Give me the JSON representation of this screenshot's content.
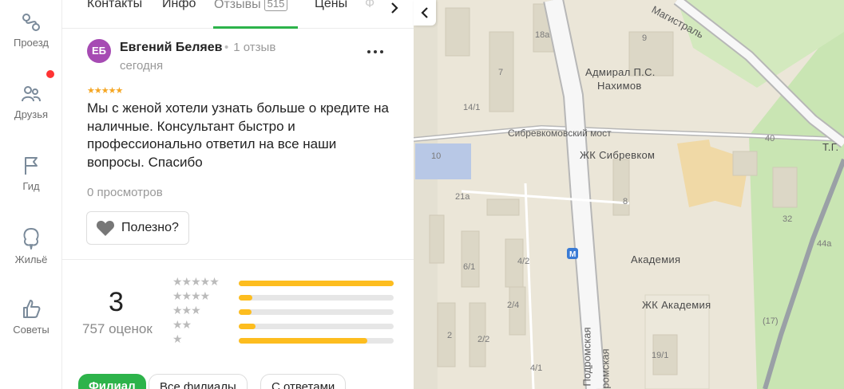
{
  "rail": {
    "items": [
      {
        "label": "Проезд",
        "icon": "route-icon"
      },
      {
        "label": "Друзья",
        "icon": "friends-icon"
      },
      {
        "label": "Гид",
        "icon": "flag-icon"
      },
      {
        "label": "Жильё",
        "icon": "tree-icon"
      },
      {
        "label": "Советы",
        "icon": "thumbs-up-icon"
      }
    ],
    "notification_color": "#ff3333"
  },
  "tabs": {
    "items": [
      {
        "label": "Контакты"
      },
      {
        "label": "Инфо"
      },
      {
        "label": "Отзывы",
        "count": "515",
        "active": true
      },
      {
        "label": "Цены"
      },
      {
        "label": "Ф"
      }
    ],
    "accent": "#2db34a"
  },
  "review": {
    "avatar_initials": "ЕБ",
    "avatar_color": "#a64bb3",
    "author": "Евгений Беляев",
    "author_reviews": "1 отзыв",
    "date": "сегодня",
    "stars": "★★★★★",
    "rating": 5,
    "text": "Мы с женой хотели узнать больше о кредите на наличные. Консультант быстро и профессионально ответил на все наши вопросы. Спасибо",
    "views": "0 просмотров",
    "useful_label": "Полезно?"
  },
  "summary": {
    "rating": "3",
    "count_label": "757 оценок",
    "distribution": [
      {
        "stars": "★★★★★",
        "fraction": 1.0
      },
      {
        "stars": "★★★★",
        "fraction": 0.09
      },
      {
        "stars": "★★★",
        "fraction": 0.08
      },
      {
        "stars": "★★",
        "fraction": 0.11
      },
      {
        "stars": "★",
        "fraction": 0.83
      }
    ],
    "bar_color": "#fdbd1f"
  },
  "chips": [
    {
      "label": "Филиал",
      "active": true
    },
    {
      "label": "Все филиалы",
      "active": false
    },
    {
      "label": "С ответами",
      "active": false
    }
  ],
  "map": {
    "labels": [
      {
        "text": "Магистраль",
        "kind": "street"
      },
      {
        "text": "Адмирал П.С.",
        "kind": "poi"
      },
      {
        "text": "Нахимов",
        "kind": "poi"
      },
      {
        "text": "Сибревкомовский мост",
        "kind": "street"
      },
      {
        "text": "ЖК Сибревком",
        "kind": "poi"
      },
      {
        "text": "Академия",
        "kind": "poi"
      },
      {
        "text": "ЖК Академия",
        "kind": "poi"
      },
      {
        "text": "Т.Г.",
        "kind": "poi"
      },
      {
        "text": "Подромская",
        "kind": "street"
      },
      {
        "text": "ромская",
        "kind": "street"
      },
      {
        "text": "18а",
        "kind": "num"
      },
      {
        "text": "9",
        "kind": "num"
      },
      {
        "text": "7",
        "kind": "num"
      },
      {
        "text": "14/1",
        "kind": "num"
      },
      {
        "text": "10",
        "kind": "num"
      },
      {
        "text": "21а",
        "kind": "num"
      },
      {
        "text": "40",
        "kind": "num"
      },
      {
        "text": "8",
        "kind": "num"
      },
      {
        "text": "32",
        "kind": "num"
      },
      {
        "text": "44а",
        "kind": "num"
      },
      {
        "text": "6/1",
        "kind": "num"
      },
      {
        "text": "4/2",
        "kind": "num"
      },
      {
        "text": "2/4",
        "kind": "num"
      },
      {
        "text": "2",
        "kind": "num"
      },
      {
        "text": "2/2",
        "kind": "num"
      },
      {
        "text": "4/1",
        "kind": "num"
      },
      {
        "text": "19/1",
        "kind": "num"
      },
      {
        "text": "(17)",
        "kind": "num"
      }
    ]
  }
}
